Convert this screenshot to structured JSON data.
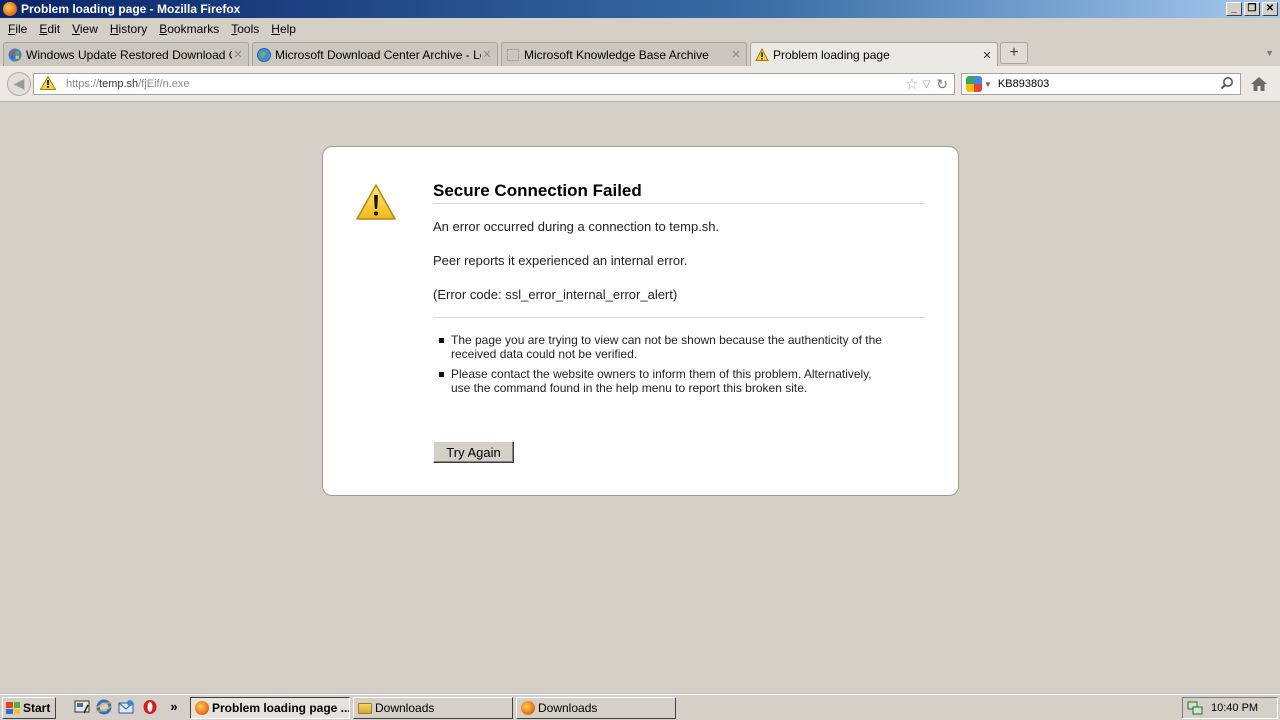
{
  "window": {
    "title": "Problem loading page - Mozilla Firefox",
    "min_glyph": "_",
    "max_glyph": "❐",
    "close_glyph": "✕"
  },
  "menu": [
    "File",
    "Edit",
    "View",
    "History",
    "Bookmarks",
    "Tools",
    "Help"
  ],
  "tabs": [
    {
      "label": "Windows Update Restored Download Ce...",
      "icon": "windows-icon",
      "active": false
    },
    {
      "label": "Microsoft Download Center Archive - Leg...",
      "icon": "globe-icon",
      "active": false
    },
    {
      "label": "Microsoft Knowledge Base Archive",
      "icon": "blank-page-icon",
      "active": false
    },
    {
      "label": "Problem loading page",
      "icon": "warning-icon",
      "active": true
    }
  ],
  "newtab_label": "+",
  "navbar": {
    "url_prefix": "https://",
    "url_host": "temp.sh",
    "url_path": "/fjEif/n.exe",
    "search_value": "KB893803"
  },
  "error": {
    "title": "Secure Connection Failed",
    "line1": "An error occurred during a connection to temp.sh.",
    "line2": "Peer reports it experienced an internal error.",
    "line3": "(Error code: ssl_error_internal_error_alert)",
    "bullets": [
      "The page you are trying to view can not be shown because the authenticity of the received data could not be verified.",
      "Please contact the website owners to inform them of this problem. Alternatively, use the command found in the help menu to report this broken site."
    ],
    "button": "Try Again"
  },
  "taskbar": {
    "start_label": "Start",
    "chevron": "»",
    "tasks": [
      {
        "label": "Problem loading page ...",
        "icon": "firefox-icon",
        "active": true
      },
      {
        "label": "Downloads",
        "icon": "folder-icon",
        "active": false
      },
      {
        "label": "Downloads",
        "icon": "firefox-icon",
        "active": false
      }
    ],
    "clock": "10:40 PM"
  }
}
